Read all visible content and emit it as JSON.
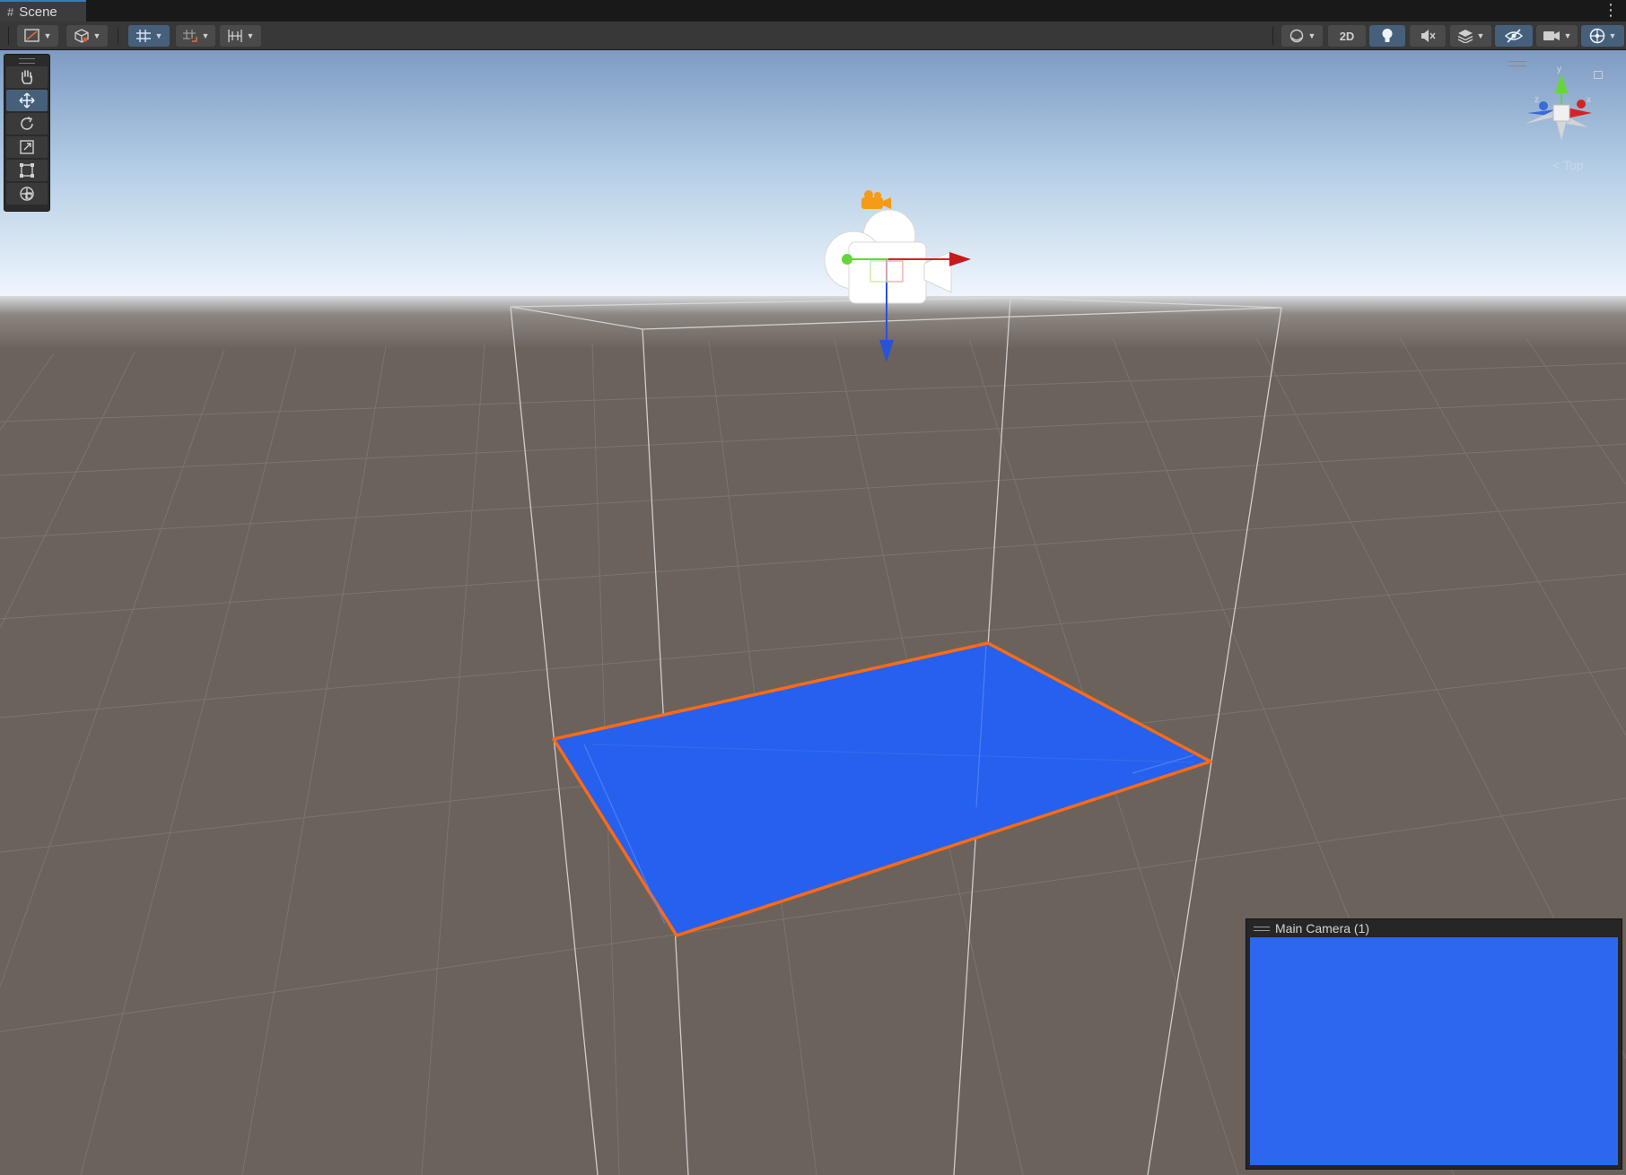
{
  "window": {
    "tab_label": "Scene",
    "tab_icon": "grid-icon",
    "menu_icon": "kebab-icon"
  },
  "toolbar": {
    "left_groups": [
      {
        "name": "draw-mode",
        "icon": "shading-icon",
        "dropdown": true
      },
      {
        "name": "gizmo-tools",
        "icon": "cube-icon",
        "dropdown": true
      },
      {
        "name": "grid-snap",
        "icon": "grid-snap-icon",
        "dropdown": true,
        "active": true
      },
      {
        "name": "increment-snap",
        "icon": "increment-snap-icon",
        "dropdown": true
      },
      {
        "name": "align",
        "icon": "align-icon",
        "dropdown": true
      }
    ],
    "right_groups": [
      {
        "name": "draw-mode-sphere",
        "icon": "sphere-icon",
        "dropdown": true
      },
      {
        "name": "2d-toggle",
        "label": "2D"
      },
      {
        "name": "lighting-toggle",
        "icon": "bulb-icon",
        "active": true
      },
      {
        "name": "audio-toggle",
        "icon": "speaker-muted-icon"
      },
      {
        "name": "effects",
        "icon": "layers-icon",
        "dropdown": true
      },
      {
        "name": "hidden-objects",
        "icon": "eye-slash-icon",
        "active": true
      },
      {
        "name": "camera-settings",
        "icon": "camera-icon",
        "dropdown": true
      },
      {
        "name": "gizmos",
        "icon": "gizmo-globe-icon",
        "dropdown": true,
        "active": true
      }
    ],
    "label_2d": "2D"
  },
  "tools": [
    {
      "name": "hand-tool",
      "icon": "hand-icon",
      "active": false
    },
    {
      "name": "move-tool",
      "icon": "move-icon",
      "active": true
    },
    {
      "name": "rotate-tool",
      "icon": "rotate-icon",
      "active": false
    },
    {
      "name": "scale-tool",
      "icon": "scale-icon",
      "active": false
    },
    {
      "name": "rect-tool",
      "icon": "rect-icon",
      "active": false
    },
    {
      "name": "transform-tool",
      "icon": "transform-icon",
      "active": false
    }
  ],
  "scene_gizmo": {
    "axes": [
      "y",
      "z",
      "x"
    ],
    "projection_label": "< Top"
  },
  "camera_preview": {
    "title": "Main Camera (1)"
  },
  "colors": {
    "sky_top": "#7f9cc4",
    "horizon": "#eef4fa",
    "ground": "#6b625c",
    "plane": "#2561ee",
    "selection_outline": "#ff6a14",
    "preview_bg": "#2d66ef",
    "axis_x": "#d42323",
    "axis_y": "#64d639",
    "axis_z": "#2a52d6"
  }
}
